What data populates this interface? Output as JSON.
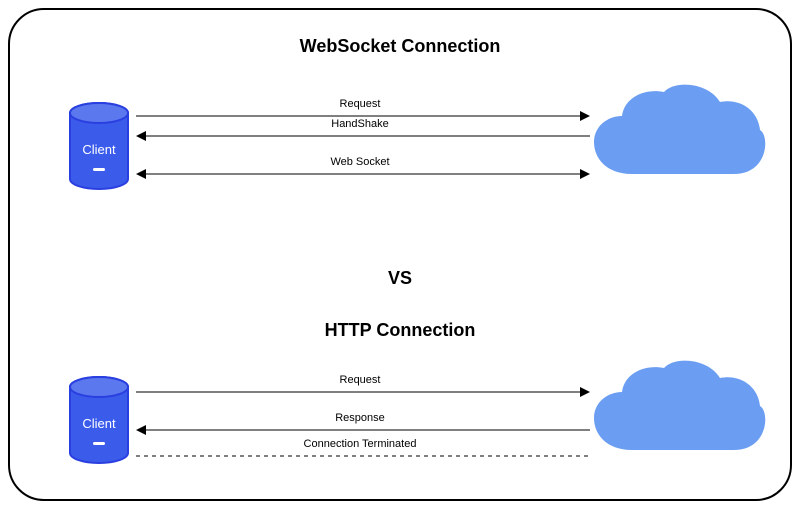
{
  "titles": {
    "websocket": "WebSocket Connection",
    "http": "HTTP Connection",
    "vs": "VS"
  },
  "client_label": "Client",
  "arrows": {
    "ws_request": "Request",
    "ws_handshake": "HandShake",
    "ws_websocket": "Web Socket",
    "http_request": "Request",
    "http_response": "Response",
    "http_terminated": "Connection Terminated"
  },
  "colors": {
    "client_fill": "#3b5beb",
    "client_stroke": "#2a3fe0",
    "cloud_fill": "#6b9ef2",
    "line": "#000"
  }
}
